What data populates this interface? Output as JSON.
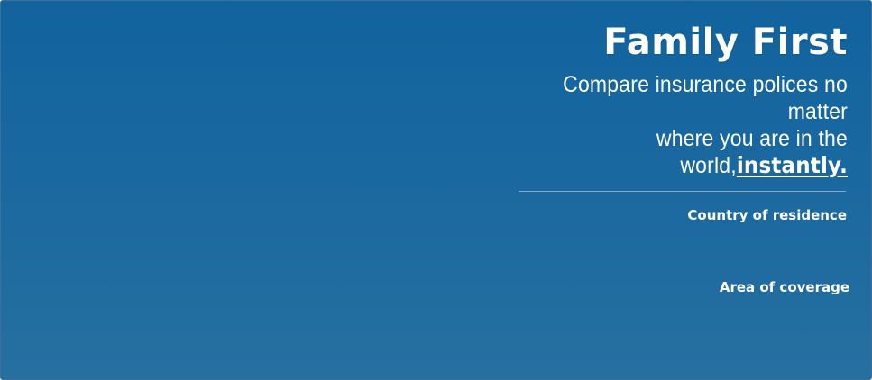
{
  "banner": {
    "title": "Family First",
    "subtitle_line1": "Compare insurance polices no matter",
    "subtitle_line2": "where you are in the world,",
    "subtitle_emphasis": "instantly.",
    "fields": {
      "country_label": "Country of residence",
      "coverage_label": "Area of coverage"
    }
  },
  "colors": {
    "gradient_top": "#11639e",
    "gradient_bottom": "#2670a0",
    "text": "#ffffff"
  }
}
